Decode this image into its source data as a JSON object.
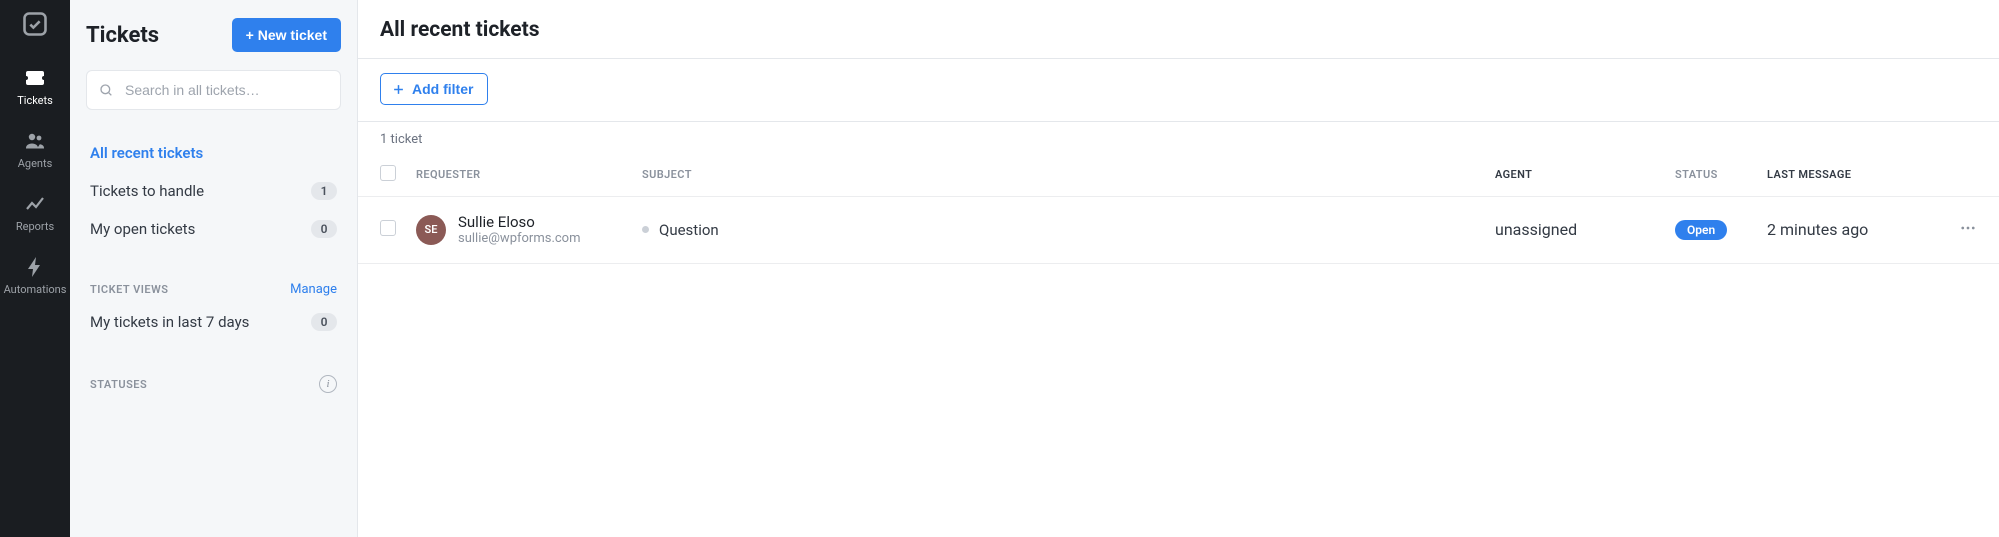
{
  "rail": {
    "items": [
      {
        "label": "Tickets"
      },
      {
        "label": "Agents"
      },
      {
        "label": "Reports"
      },
      {
        "label": "Automations"
      }
    ]
  },
  "sidebar": {
    "title": "Tickets",
    "new_button": "+ New ticket",
    "search_placeholder": "Search in all tickets…",
    "nav": [
      {
        "label": "All recent tickets",
        "count": null
      },
      {
        "label": "Tickets to handle",
        "count": "1"
      },
      {
        "label": "My open tickets",
        "count": "0"
      }
    ],
    "views_section_label": "TICKET VIEWS",
    "views_manage": "Manage",
    "views": [
      {
        "label": "My tickets in last 7 days",
        "count": "0"
      }
    ],
    "statuses_section_label": "STATUSES"
  },
  "main": {
    "title": "All recent tickets",
    "add_filter": "Add filter",
    "count_text": "1 ticket",
    "columns": {
      "requester": "REQUESTER",
      "subject": "SUBJECT",
      "agent": "AGENT",
      "status": "STATUS",
      "last_message": "LAST MESSAGE"
    },
    "rows": [
      {
        "initials": "SE",
        "name": "Sullie Eloso",
        "email": "sullie@wpforms.com",
        "subject": "Question",
        "agent": "unassigned",
        "status": "Open",
        "last_message": "2 minutes ago"
      }
    ]
  }
}
